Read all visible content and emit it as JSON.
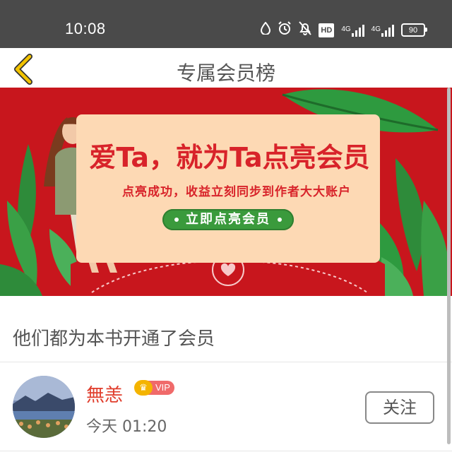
{
  "statusbar": {
    "time": "10:08",
    "battery": "90",
    "hd_label": "HD",
    "net_labels": [
      "4G",
      "4G"
    ],
    "icons": [
      "drop-icon",
      "alarm-icon",
      "mute-bell-icon",
      "hd-icon",
      "signal-icon",
      "signal-icon",
      "battery-icon"
    ]
  },
  "header": {
    "title": "专属会员榜",
    "back_icon": "chevron-left-icon",
    "accent": "#f2c300"
  },
  "banner": {
    "title": "爱Ta，就为Ta点亮会员",
    "subtitle": "点亮成功，收益立刻同步到作者大大账户",
    "cta_label": "立即点亮会员",
    "colors": {
      "background": "#c8161d",
      "card": "#fdd9b4",
      "cta": "#3a9a3c",
      "text": "#d8232a"
    }
  },
  "section": {
    "title": "他们都为本书开通了会员"
  },
  "members": [
    {
      "name": "無恙",
      "badge": "VIP",
      "time": "今天 01:20",
      "follow_label": "关注",
      "name_color": "#e03d2c"
    }
  ]
}
